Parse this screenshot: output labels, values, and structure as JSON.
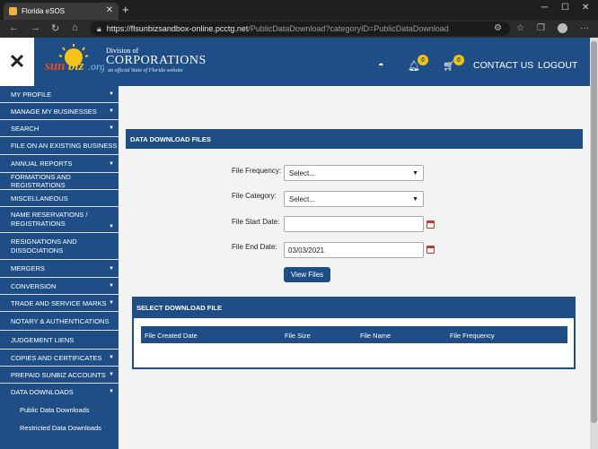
{
  "browser": {
    "tab_title": "Florida eSOS",
    "url_host": "https://flsunbizsandbox-online.pcctg.net",
    "url_path": "/PublicDataDownload?categoryID=PublicDataDownload"
  },
  "header": {
    "logo_division": "Division of",
    "logo_corporations": "CORPORATIONS",
    "logo_tagline": "an official State of Florida website",
    "notification_count": "0",
    "cart_count": "0",
    "contact_label": "CONTACT US",
    "logout_label": "LOGOUT"
  },
  "sidebar": {
    "items": [
      {
        "label": "MY PROFILE",
        "caret": true
      },
      {
        "label": "MANAGE MY BUSINESSES",
        "caret": true
      },
      {
        "label": "SEARCH",
        "caret": true
      },
      {
        "label": "FILE ON AN EXISTING BUSINESS",
        "caret": false
      },
      {
        "label": "ANNUAL REPORTS",
        "caret": true
      },
      {
        "label": "FORMATIONS AND REGISTRATIONS",
        "caret": false
      },
      {
        "label": "MISCELLANEOUS",
        "caret": false
      },
      {
        "label": "NAME RESERVATIONS / REGISTRATIONS",
        "caret": true
      },
      {
        "label": "RESIGNATIONS AND DISSOCIATIONS",
        "caret": false
      },
      {
        "label": "MERGERS",
        "caret": true
      },
      {
        "label": "CONVERSION",
        "caret": true
      },
      {
        "label": "TRADE AND SERVICE MARKS",
        "caret": true
      },
      {
        "label": "NOTARY & AUTHENTICATIONS",
        "caret": false
      },
      {
        "label": "JUDGEMENT LIENS",
        "caret": false
      },
      {
        "label": "COPIES AND CERTIFICATES",
        "caret": true
      },
      {
        "label": "PREPAID SUNBIZ ACCOUNTS",
        "caret": true
      },
      {
        "label": "DATA DOWNLOADS",
        "caret": true
      }
    ],
    "sub_items": [
      "Public Data Downloads",
      "Restricted Data Downloads"
    ]
  },
  "main": {
    "section_title": "DATA DOWNLOAD FILES",
    "form": {
      "frequency_label": "File Frequency:",
      "frequency_value": "Select...",
      "category_label": "File Category:",
      "category_value": "Select...",
      "start_label": "File Start Date:",
      "start_value": "",
      "end_label": "File End Date:",
      "end_value": "03/03/2021",
      "view_button": "View Files"
    },
    "download_panel": {
      "title": "SELECT DOWNLOAD FILE",
      "columns": [
        "File Created Date",
        "File Size",
        "File Name",
        "File Frequency"
      ]
    }
  }
}
